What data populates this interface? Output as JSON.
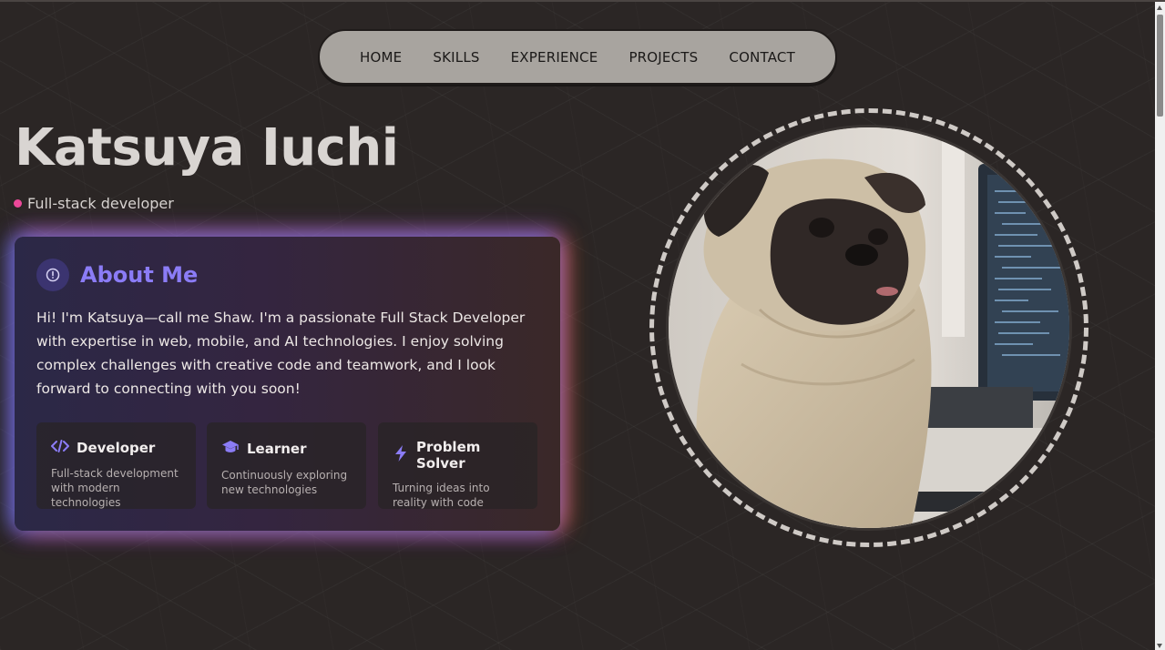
{
  "nav": {
    "items": [
      "HOME",
      "SKILLS",
      "EXPERIENCE",
      "PROJECTS",
      "CONTACT"
    ]
  },
  "hero": {
    "name": "Katsuya Iuchi",
    "role": "Full-stack developer"
  },
  "about": {
    "title": "About Me",
    "text": "Hi! I'm Katsuya—call me Shaw. I'm a passionate Full Stack Developer with expertise in web, mobile, and AI technologies. I enjoy solving complex challenges with creative code and teamwork, and I look forward to connecting with you soon!",
    "features": [
      {
        "title": "Developer",
        "desc": "Full-stack development with modern technologies",
        "icon": "code-icon"
      },
      {
        "title": "Learner",
        "desc": "Continuously exploring new technologies",
        "icon": "graduation-cap-icon"
      },
      {
        "title": "Problem Solver",
        "desc": "Turning ideas into reality with code",
        "icon": "lightning-icon"
      }
    ]
  },
  "colors": {
    "background": "#2b2625",
    "accent": "#8b7cf6",
    "pink_dot": "#ec4899",
    "nav_bg": "#a8a49f"
  }
}
